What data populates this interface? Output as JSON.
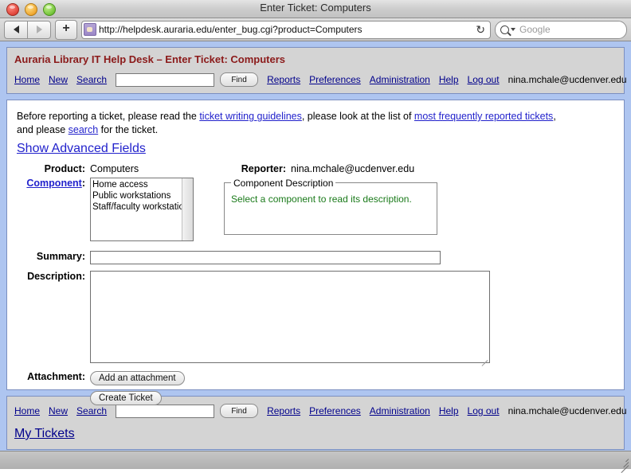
{
  "browser": {
    "title": "Enter Ticket: Computers",
    "url": "http://helpdesk.auraria.edu/enter_bug.cgi?product=Computers",
    "search_placeholder": "Google",
    "back_icon": "back-arrow-icon",
    "forward_icon": "forward-arrow-icon",
    "add_tab_label": "+",
    "reload_icon": "↻",
    "traffic_lights": [
      "close",
      "minimize",
      "zoom"
    ]
  },
  "header": {
    "site_title": "Auraria Library IT Help Desk – Enter Ticket: Computers",
    "nav": [
      {
        "label": "Home"
      },
      {
        "label": "New"
      },
      {
        "label": "Search"
      }
    ],
    "find_button": "Find",
    "search_value": "",
    "nav_after": [
      {
        "label": "Reports"
      },
      {
        "label": "Preferences"
      },
      {
        "label": "Administration"
      },
      {
        "label": "Help"
      },
      {
        "label": "Log out"
      }
    ],
    "user": "nina.mchale@ucdenver.edu"
  },
  "intro": {
    "before_1": "Before reporting a ticket, please read the ",
    "link_guidelines": "ticket writing guidelines",
    "before_2": ", please look at the list of ",
    "link_frequent": "most frequently reported tickets",
    "before_3": ",",
    "line2_a": "and please ",
    "link_search": "search",
    "line2_b": " for the ticket.",
    "advanced_link": "Show Advanced Fields"
  },
  "form": {
    "product_label": "Product:",
    "product_value": "Computers",
    "reporter_label": "Reporter:",
    "reporter_value": "nina.mchale@ucdenver.edu",
    "component_label": "Component",
    "component_colon": ":",
    "component_options": [
      "Home access",
      "Public workstations",
      "Staff/faculty workstation"
    ],
    "component_description_legend": "Component Description",
    "component_description_text": "Select a component to read its description.",
    "summary_label": "Summary:",
    "summary_value": "",
    "description_label": "Description:",
    "description_value": "",
    "attachment_label": "Attachment:",
    "attachment_button": "Add an attachment",
    "submit_button": "Create Ticket"
  },
  "footer": {
    "nav": [
      {
        "label": "Home"
      },
      {
        "label": "New"
      },
      {
        "label": "Search"
      }
    ],
    "find_button": "Find",
    "search_value": "",
    "nav_after": [
      {
        "label": "Reports"
      },
      {
        "label": "Preferences"
      },
      {
        "label": "Administration"
      },
      {
        "label": "Help"
      },
      {
        "label": "Log out"
      }
    ],
    "user": "nina.mchale@ucdenver.edu",
    "my_tickets": "My Tickets"
  },
  "colors": {
    "page_background": "#aec5f0",
    "panel_background": "#d4d4d4",
    "site_title": "#8b1a1a",
    "link": "#2222cc",
    "nav_link": "#00008b",
    "description_text": "#1a7a1a"
  }
}
